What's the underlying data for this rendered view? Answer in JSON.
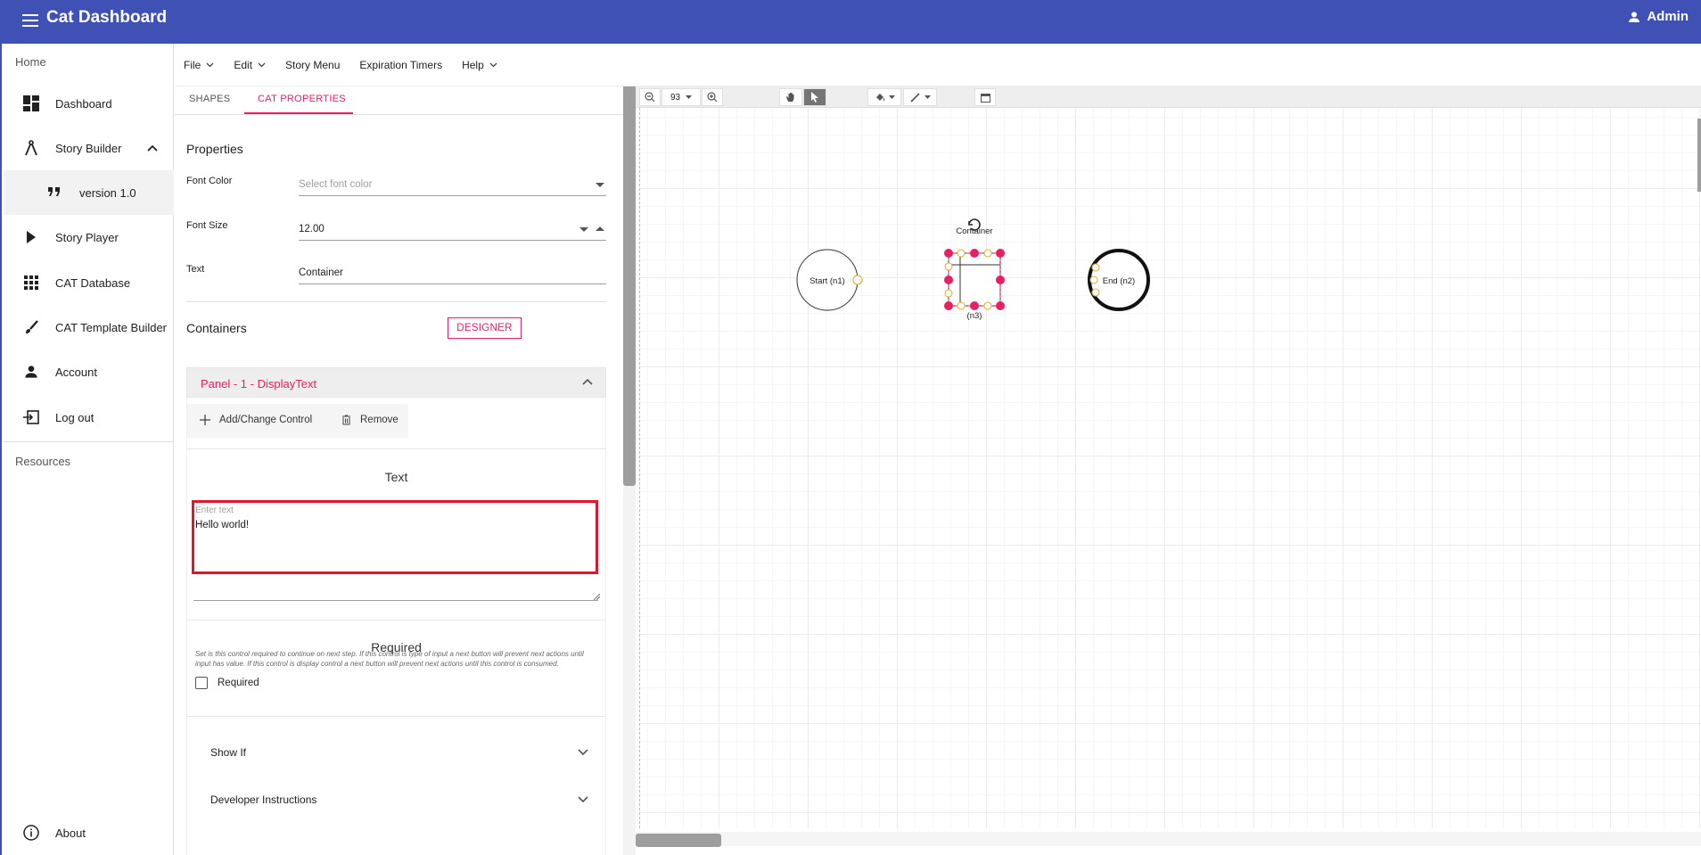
{
  "app": {
    "title": "Cat Dashboard",
    "user": "Admin"
  },
  "sidebar": {
    "home_label": "Home",
    "resources_label": "Resources",
    "items": [
      {
        "label": "Dashboard",
        "icon": "dashboard-icon"
      },
      {
        "label": "Story Builder",
        "icon": "compass-icon"
      },
      {
        "label": "version 1.0",
        "icon": "quote-icon"
      },
      {
        "label": "Story Player",
        "icon": "play-icon"
      },
      {
        "label": "CAT Database",
        "icon": "grid-icon"
      },
      {
        "label": "CAT Template Builder",
        "icon": "brush-icon"
      },
      {
        "label": "Account",
        "icon": "person-icon"
      },
      {
        "label": "Log out",
        "icon": "logout-icon"
      }
    ],
    "about_label": "About"
  },
  "menubar": {
    "items": [
      "File",
      "Edit",
      "Story Menu",
      "Expiration Timers",
      "Help"
    ]
  },
  "panel": {
    "tabs": [
      "SHAPES",
      "CAT PROPERTIES"
    ],
    "properties_title": "Properties",
    "font_color_label": "Font Color",
    "font_color_placeholder": "Select font color",
    "font_size_label": "Font Size",
    "font_size_value": "12.00",
    "text_label": "Text",
    "text_value": "Container",
    "containers_title": "Containers",
    "designer_button": "DESIGNER",
    "accordion_title": "Panel - 1 - DisplayText",
    "add_change_label": "Add/Change Control",
    "remove_label": "Remove",
    "text_section_title": "Text",
    "textarea_placeholder": "Enter text",
    "textarea_value": "Hello world!",
    "required_section_title": "Required",
    "required_help": "Set is this control required to continue on next step. If this control is type of input a next button will prevent next actions until input has value. If this control is display control a next button will prevent next actions until this control is consumed.",
    "required_checkbox_label": "Required",
    "show_if_label": "Show If",
    "developer_instructions_label": "Developer Instructions"
  },
  "diagram": {
    "zoom_value": "93",
    "nodes": {
      "start": "Start (n1)",
      "end": "End (n2)",
      "container_title": "Container",
      "container_id": "(n3)"
    },
    "colors": {
      "selection": "#e91e63",
      "port": "#f5c542",
      "accent": "#3f51b5"
    }
  }
}
